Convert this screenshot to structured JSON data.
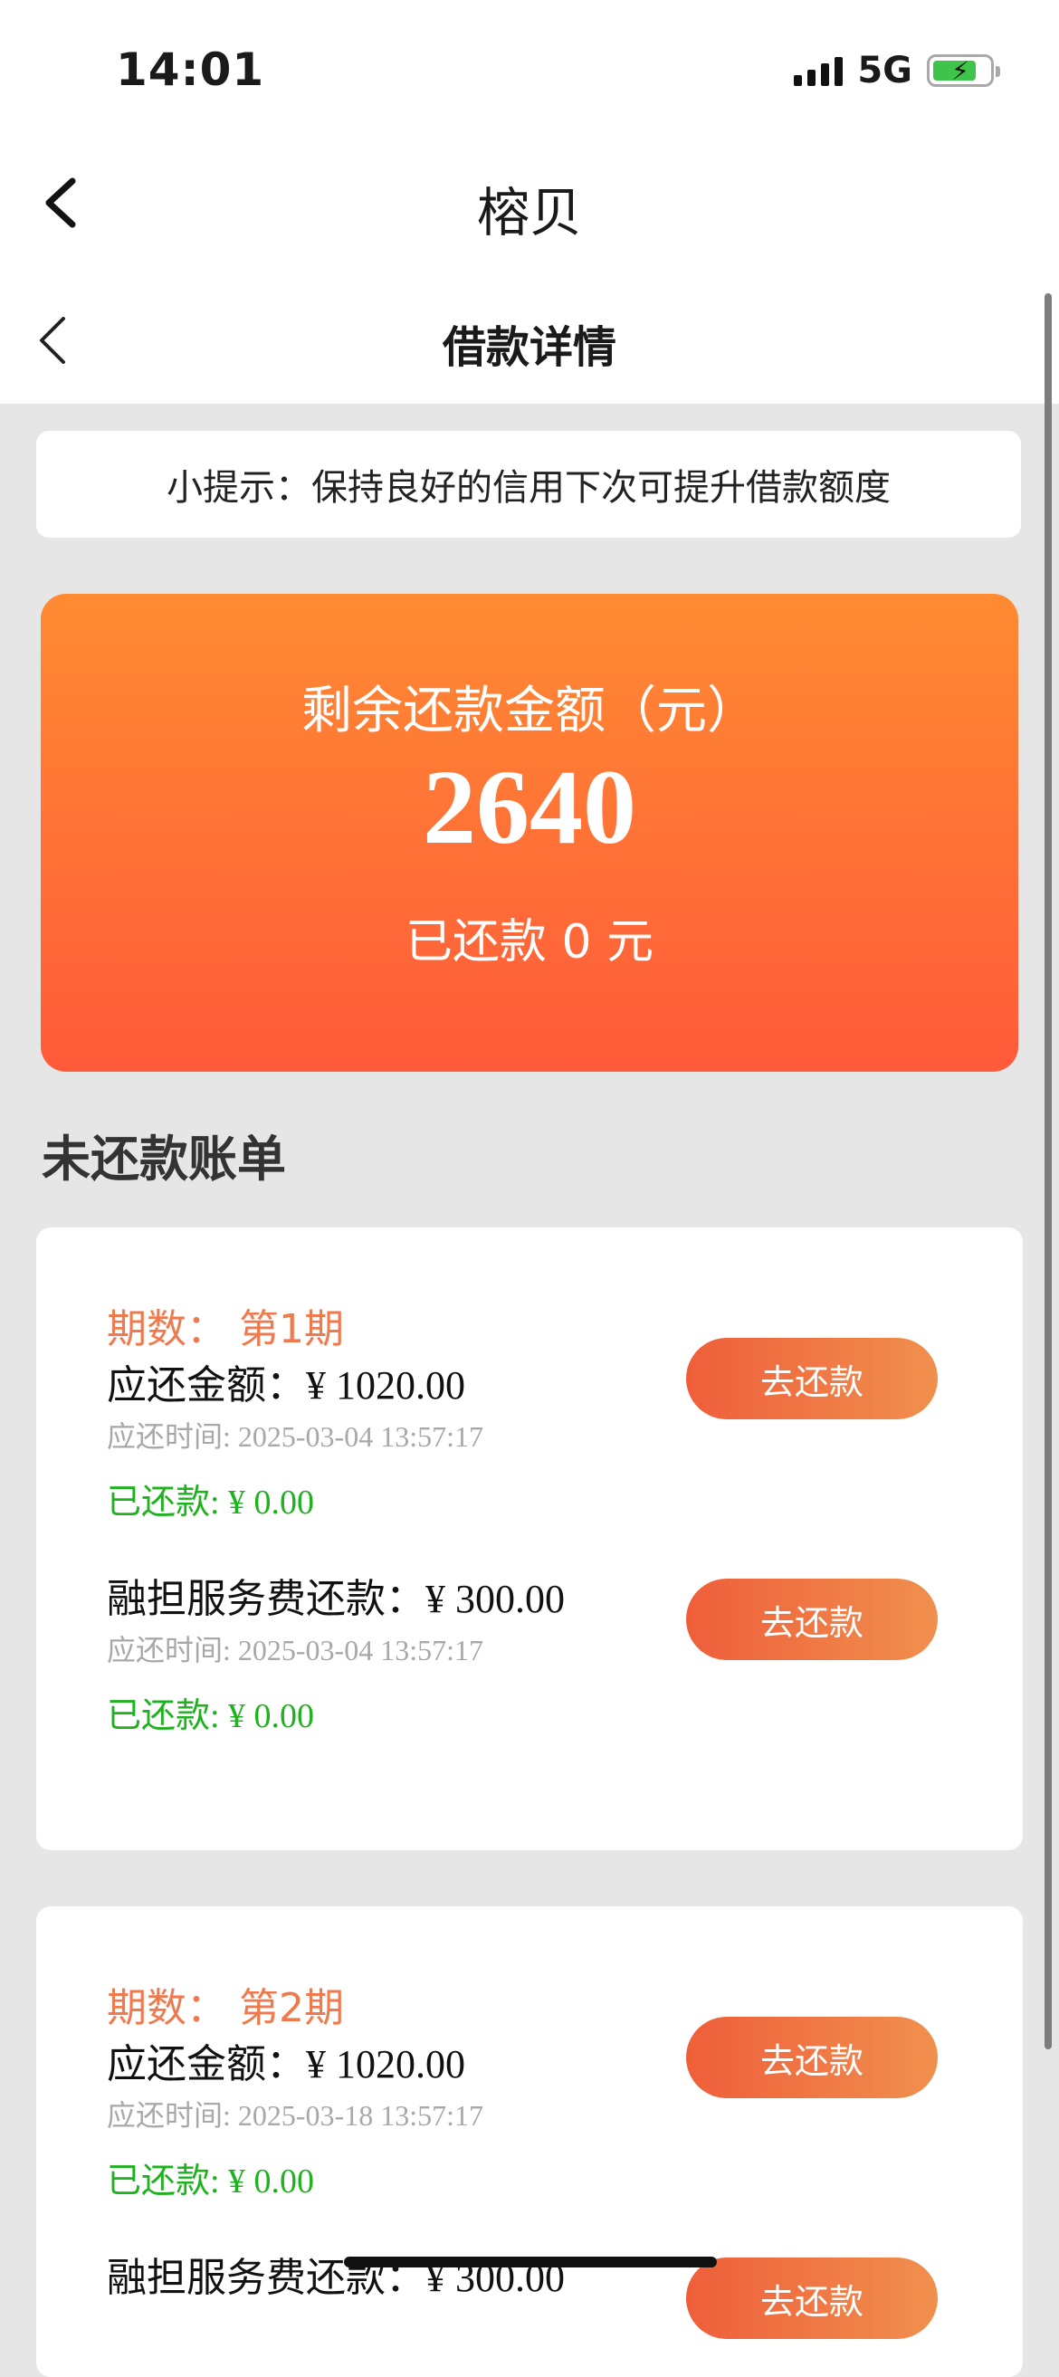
{
  "status_bar": {
    "time": "14:01",
    "network": "5G",
    "battery_fill": 0.75
  },
  "mini_app": {
    "title": "榕贝",
    "back_icon": "chevron-left-icon"
  },
  "header": {
    "title": "借款详情",
    "back_icon": "chevron-left-icon"
  },
  "tip": {
    "text": "小提示：保持良好的信用下次可提升借款额度"
  },
  "summary": {
    "label": "剩余还款金额（元）",
    "amount": "2640",
    "paid_text": "已还款 0 元"
  },
  "section": {
    "title": "未还款账单"
  },
  "bills": [
    {
      "period": "期数：  第1期",
      "principal_label": "应还金额：",
      "principal_value": "¥ 1020.00",
      "principal_due": "应还时间: 2025-03-04 13:57:17",
      "principal_paid": "已还款: ¥ 0.00",
      "fee_label": "融担服务费还款：",
      "fee_value": "¥ 300.00",
      "fee_due": "应还时间: 2025-03-04 13:57:17",
      "fee_paid": "已还款: ¥ 0.00",
      "button": "去还款"
    },
    {
      "period": "期数：  第2期",
      "principal_label": "应还金额：",
      "principal_value": "¥ 1020.00",
      "principal_due": "应还时间: 2025-03-18 13:57:17",
      "principal_paid": "已还款: ¥ 0.00",
      "fee_label": "融担服务费还款：",
      "fee_value": "¥ 300.00",
      "button": "去还款"
    }
  ],
  "colors": {
    "accent_orange": "#f07a4e",
    "hero_gradient_top": "#ff8b32",
    "hero_gradient_bottom": "#ff5a3a",
    "paid_green": "#1fb21f",
    "background_gray": "#e6e6e6"
  }
}
